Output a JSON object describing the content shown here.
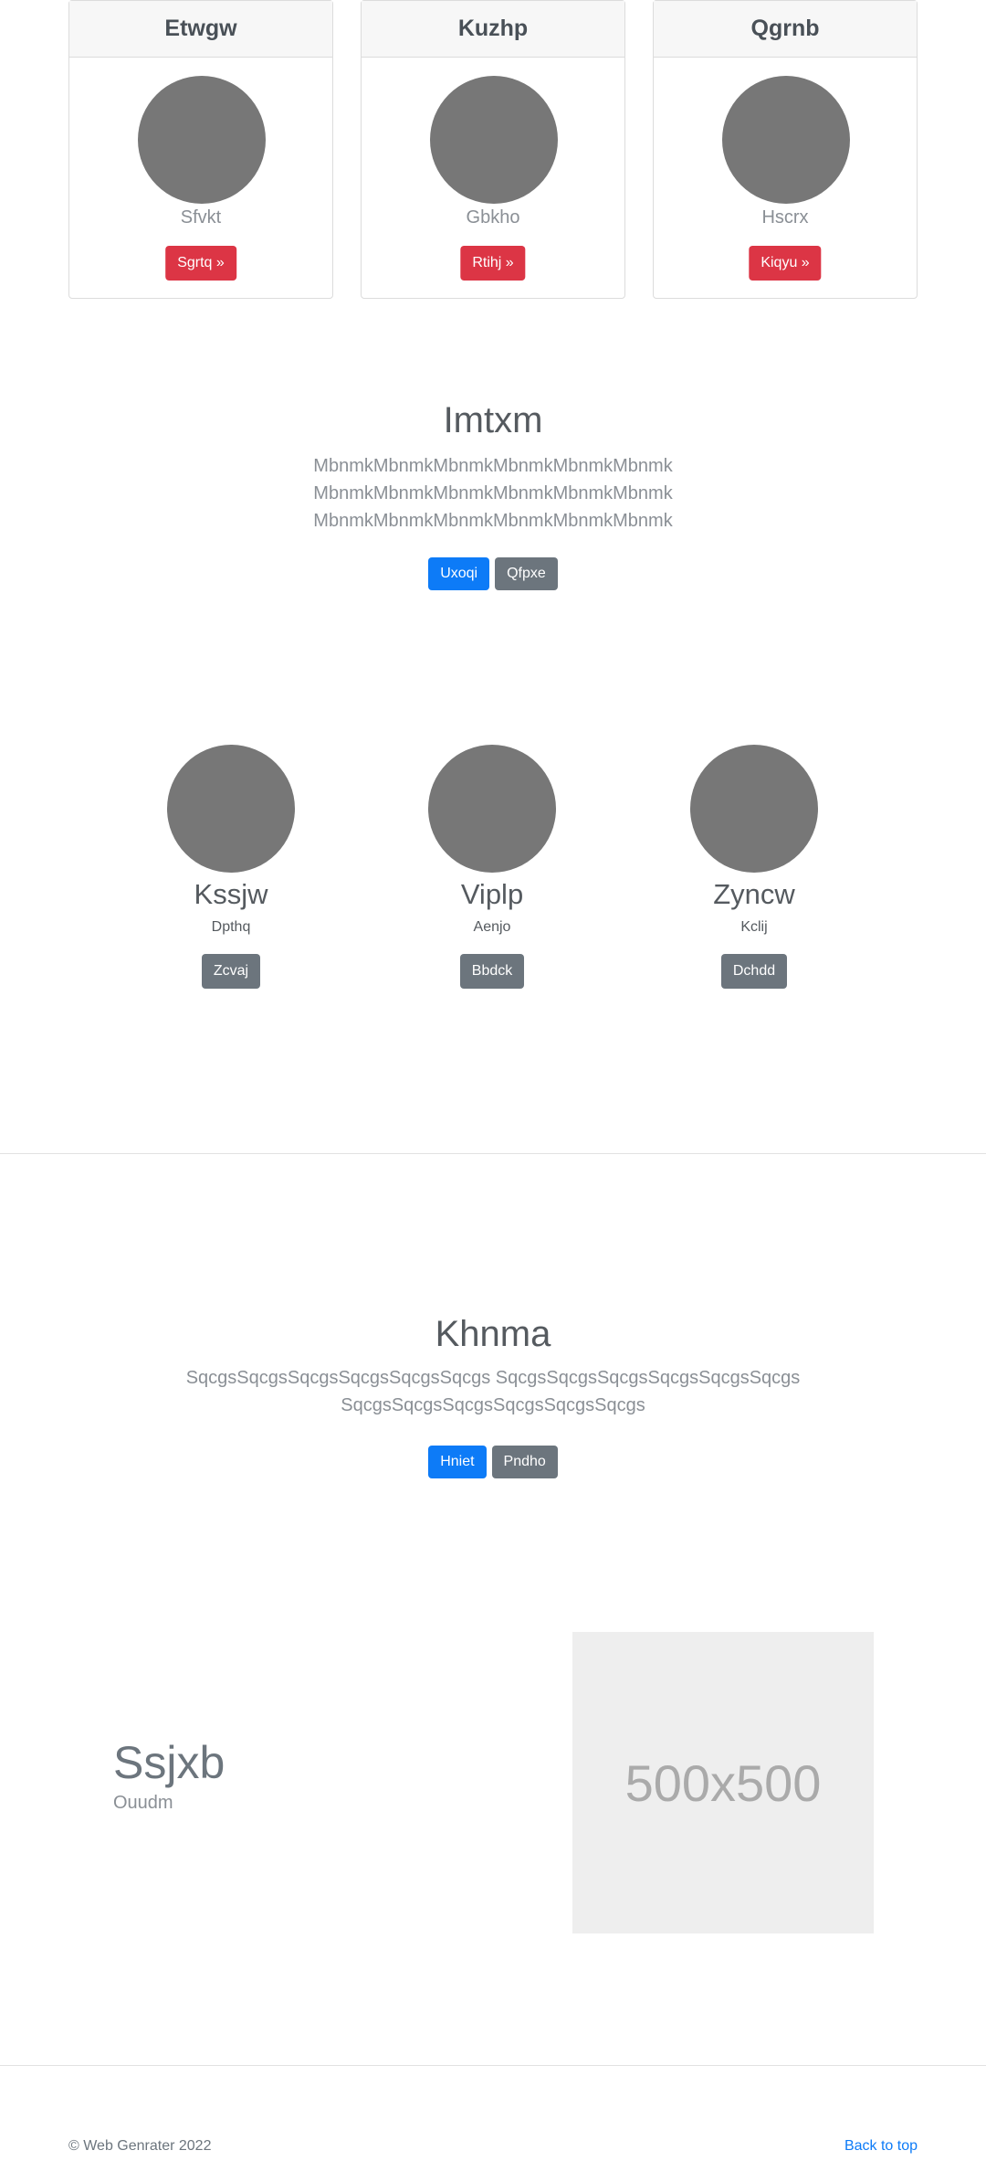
{
  "cards": [
    {
      "title": "Etwgw",
      "subtitle": "Sfvkt",
      "button": "Sgrtq »"
    },
    {
      "title": "Kuzhp",
      "subtitle": "Gbkho",
      "button": "Rtihj »"
    },
    {
      "title": "Qgrnb",
      "subtitle": "Hscrx",
      "button": "Kiqyu »"
    }
  ],
  "hero1": {
    "title": "Imtxm",
    "lines": [
      "MbnmkMbnmkMbnmkMbnmkMbnmkMbnmk",
      "MbnmkMbnmkMbnmkMbnmkMbnmkMbnmk",
      "MbnmkMbnmkMbnmkMbnmkMbnmkMbnmk"
    ],
    "primary": "Uxoqi",
    "secondary": "Qfpxe"
  },
  "team": [
    {
      "name": "Kssjw",
      "role": "Dpthq",
      "button": "Zcvaj"
    },
    {
      "name": "Viplp",
      "role": "Aenjo",
      "button": "Bbdck"
    },
    {
      "name": "Zyncw",
      "role": "Kclij",
      "button": "Dchdd"
    }
  ],
  "hero2": {
    "title": "Khnma",
    "lines": [
      "SqcgsSqcgsSqcgsSqcgsSqcgsSqcgs SqcgsSqcgsSqcgsSqcgsSqcgsSqcgs",
      "SqcgsSqcgsSqcgsSqcgsSqcgsSqcgs"
    ],
    "primary": "Hniet",
    "secondary": "Pndho"
  },
  "feature": {
    "title": "Ssjxb",
    "subtitle": "Ouudm",
    "placeholder": "500x500"
  },
  "footer": {
    "copyright": "© Web Genrater 2022",
    "back_to_top": "Back to top"
  }
}
